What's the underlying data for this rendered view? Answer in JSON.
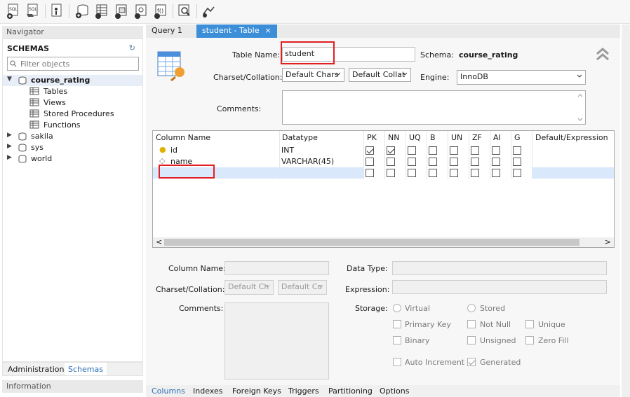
{
  "toolbar": {
    "icons": [
      "new-sql-tab-icon",
      "open-sql-script-icon",
      "inspector-icon",
      "create-schema-icon",
      "create-table-icon",
      "create-view-icon",
      "create-procedure-icon",
      "create-function-icon",
      "search-table-data-icon",
      "reconnect-icon"
    ],
    "sql_label": "SQL"
  },
  "navigator": {
    "header": "Navigator",
    "schemas_title": "SCHEMAS",
    "filter_placeholder": "Filter objects",
    "schemas": [
      {
        "name": "course_rating",
        "expanded": true,
        "children": [
          "Tables",
          "Views",
          "Stored Procedures",
          "Functions"
        ]
      },
      {
        "name": "sakila"
      },
      {
        "name": "sys"
      },
      {
        "name": "world"
      }
    ],
    "tabs": [
      "Administration",
      "Schemas"
    ],
    "active_tab": "Schemas",
    "info_header": "Information"
  },
  "editor_tabs": [
    {
      "label": "Query 1",
      "active": false
    },
    {
      "label": "student - Table",
      "active": true,
      "close": "×"
    }
  ],
  "table_editor": {
    "table_name_label": "Table Name:",
    "table_name_value": "student",
    "schema_label": "Schema:",
    "schema_value": "course_rating",
    "charset_label": "Charset/Collation:",
    "charset_value": "Default Chars",
    "collation_value": "Default Collat",
    "engine_label": "Engine:",
    "engine_value": "InnoDB",
    "comments_label": "Comments:",
    "comments_value": ""
  },
  "columns_grid": {
    "headers": [
      "Column Name",
      "Datatype",
      "PK",
      "NN",
      "UQ",
      "B",
      "UN",
      "ZF",
      "AI",
      "G",
      "Default/Expression"
    ],
    "rows": [
      {
        "name": "id",
        "icon": "primary-key-icon",
        "datatype": "INT",
        "flags": [
          true,
          true,
          false,
          false,
          false,
          false,
          false,
          false
        ],
        "default": ""
      },
      {
        "name": "name",
        "icon": "column-diamond-icon",
        "datatype": "VARCHAR(45)",
        "flags": [
          false,
          false,
          false,
          false,
          false,
          false,
          false,
          false
        ],
        "default": ""
      },
      {
        "name": "",
        "icon": "",
        "datatype": "",
        "flags": [
          false,
          false,
          false,
          false,
          false,
          false,
          false,
          false
        ],
        "default": ""
      }
    ],
    "scroll_left": "<",
    "scroll_right": ">"
  },
  "column_details": {
    "column_name_label": "Column Name:",
    "charset_label": "Charset/Collation:",
    "charset_value": "Default Ch",
    "collation_value": "Default Co",
    "comments_label": "Comments:",
    "data_type_label": "Data Type:",
    "expression_label": "Expression:",
    "storage_label": "Storage:",
    "storage_options": [
      "Virtual",
      "Stored"
    ],
    "checkboxes": [
      {
        "label": "Primary Key",
        "checked": false
      },
      {
        "label": "Not Null",
        "checked": false
      },
      {
        "label": "Unique",
        "checked": false
      },
      {
        "label": "Binary",
        "checked": false
      },
      {
        "label": "Unsigned",
        "checked": false
      },
      {
        "label": "Zero Fill",
        "checked": false
      },
      {
        "label": "Auto Increment",
        "checked": false
      },
      {
        "label": "Generated",
        "checked": true
      }
    ]
  },
  "bottom_tabs": [
    "Columns",
    "Indexes",
    "Foreign Keys",
    "Triggers",
    "Partitioning",
    "Options"
  ],
  "active_bottom_tab": "Columns",
  "colors": {
    "accent": "#3c8ed8",
    "highlight": "#e02020",
    "selection": "#d9e8fb"
  }
}
